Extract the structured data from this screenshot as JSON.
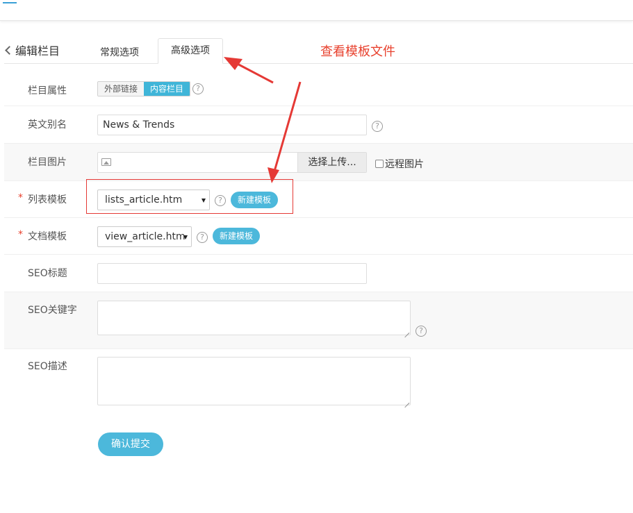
{
  "header": {
    "menu_icon": "hamburger-menu-icon"
  },
  "title_bar": {
    "back_icon": "chevron-left-icon",
    "back_label": "编辑栏目",
    "tabs": [
      {
        "label": "常规选项",
        "active": false
      },
      {
        "label": "高级选项",
        "active": true
      }
    ]
  },
  "annotation": {
    "hint_text": "查看模板文件",
    "color": "#e8412e"
  },
  "form": {
    "column_type": {
      "label": "栏目属性",
      "options": [
        "外部链接",
        "内容栏目"
      ],
      "selected": "内容栏目"
    },
    "english_alias": {
      "label": "英文别名",
      "value": "News & Trends"
    },
    "column_image": {
      "label": "栏目图片",
      "value": "",
      "upload_label": "选择上传...",
      "remote_label": "远程图片",
      "remote_checked": false
    },
    "list_template": {
      "required_mark": "*",
      "label": "列表模板",
      "value": "lists_article.htm",
      "new_button": "新建模板"
    },
    "doc_template": {
      "required_mark": "*",
      "label": "文档模板",
      "value": "view_article.htm",
      "new_button": "新建模板"
    },
    "seo_title": {
      "label": "SEO标题",
      "value": ""
    },
    "seo_keywords": {
      "label": "SEO关键字",
      "value": ""
    },
    "seo_description": {
      "label": "SEO描述",
      "value": ""
    },
    "help_glyph": "?",
    "submit_label": "确认提交"
  },
  "colors": {
    "accent": "#4cb8db",
    "toggle_active": "#3fb5d8",
    "annotation_red": "#e53935"
  }
}
